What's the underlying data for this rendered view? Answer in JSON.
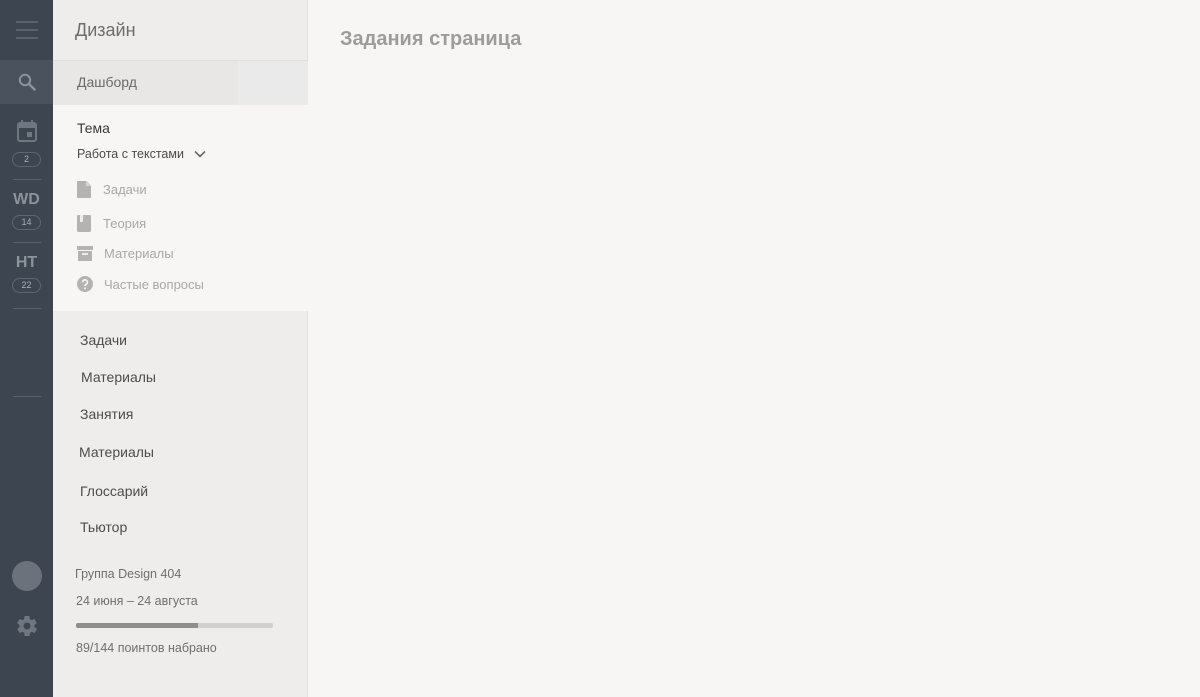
{
  "rail": {
    "items": [
      {
        "name": "menu",
        "icon": "hamburger-icon"
      },
      {
        "name": "search",
        "icon": "search-icon"
      },
      {
        "name": "calendar",
        "icon": "calendar-icon",
        "badge": "2"
      },
      {
        "name": "wd",
        "abbr": "WD",
        "badge": "14"
      },
      {
        "name": "ht",
        "abbr": "HT",
        "badge": "22"
      },
      {
        "name": "avatar",
        "icon": "avatar-icon"
      },
      {
        "name": "settings",
        "icon": "gear-icon"
      }
    ],
    "background": "#3d4550"
  },
  "sidebar": {
    "title": "Дизайн",
    "dashboard_label": "Дашборд",
    "topic": {
      "label": "Тема",
      "selected": "Работа с текстами",
      "items": [
        {
          "label": "Задачи",
          "icon": "document-icon"
        },
        {
          "label": "Теория",
          "icon": "book-icon"
        },
        {
          "label": "Материалы",
          "icon": "archive-icon"
        },
        {
          "label": "Частые вопросы",
          "icon": "help-circle-icon"
        }
      ]
    },
    "nav": [
      {
        "label": "Задачи"
      },
      {
        "label": "Материалы"
      },
      {
        "label": "Занятия"
      },
      {
        "label": "Материалы"
      },
      {
        "label": "Глоссарий"
      },
      {
        "label": "Тьютор"
      }
    ],
    "group": {
      "name": "Группа Design 404",
      "dates": "24 июня – 24 августа",
      "progress_fraction": 0.618,
      "points_text": "89/144 поинтов набрано"
    }
  },
  "main": {
    "title": "Задания страница"
  },
  "colors": {
    "page_bg": "#f7f6f5",
    "sidebar_bg": "#eeedec",
    "rail_bg": "#3d4550",
    "rail_icon": "#8c939b"
  }
}
